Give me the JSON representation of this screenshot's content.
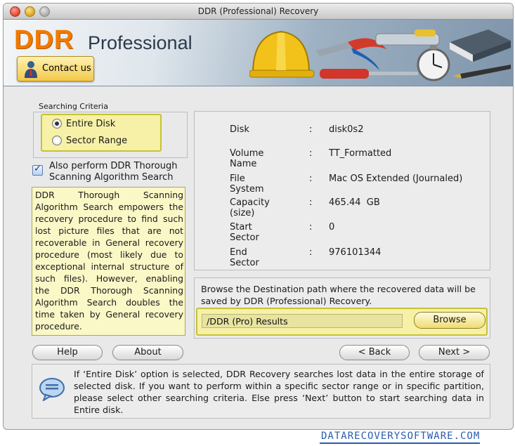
{
  "window": {
    "title": "DDR (Professional) Recovery"
  },
  "banner": {
    "brand": "DDR",
    "edition": "Professional",
    "contact_label": "Contact us"
  },
  "criteria": {
    "legend": "Searching Criteria",
    "options": [
      {
        "label": "Entire Disk",
        "selected": true
      },
      {
        "label": "Sector Range",
        "selected": false
      }
    ],
    "thorough_label": "Also perform DDR Thorough Scanning Algorithm Search",
    "thorough_checked": true,
    "description": "DDR Thorough Scanning Algorithm Search empowers the recovery procedure to find such lost picture files that are not recoverable in General recovery procedure (most likely due to exceptional internal structure of such files). However, enabling the DDR Thorough Scanning Algorithm Search doubles the time taken by General recovery procedure."
  },
  "disk_info": {
    "rows": [
      {
        "key": "Disk",
        "sep": ":",
        "value": "disk0s2"
      },
      {
        "key": "Volume Name",
        "sep": ":",
        "value": "TT_Formatted"
      },
      {
        "key": "File System",
        "sep": ":",
        "value": "Mac OS Extended (Journaled)"
      },
      {
        "key": "Capacity (size)",
        "sep": ":",
        "value": "465.44  GB"
      },
      {
        "key": "Start Sector",
        "sep": ":",
        "value": "0"
      },
      {
        "key": "End Sector",
        "sep": ":",
        "value": "976101344"
      }
    ]
  },
  "destination": {
    "prompt": "Browse the Destination path where the recovered data will be saved by DDR (Professional) Recovery.",
    "path": "/DDR (Pro) Results",
    "browse_label": "Browse"
  },
  "buttons": {
    "help": "Help",
    "about": "About",
    "back": "< Back",
    "next": "Next >"
  },
  "hint": "If ‘Entire Disk’ option is selected, DDR Recovery searches lost data in the entire storage of selected disk. If you want to perform within a specific sector range or in specific partition, please select other searching criteria. Else press ‘Next’ button to start searching data in Entire disk.",
  "footer": {
    "site": "DATARECOVERYSOFTWARE.COM"
  },
  "colors": {
    "brand_orange": "#f07a00",
    "highlight_yellow": "#f6f1a6",
    "link_blue": "#2a5bb0"
  },
  "icons": [
    "hard-hat-icon",
    "pliers-icon",
    "screwdriver-icon",
    "stopwatch-icon",
    "book-icon",
    "pen-icon",
    "chat-bubble-icon",
    "person-icon"
  ]
}
